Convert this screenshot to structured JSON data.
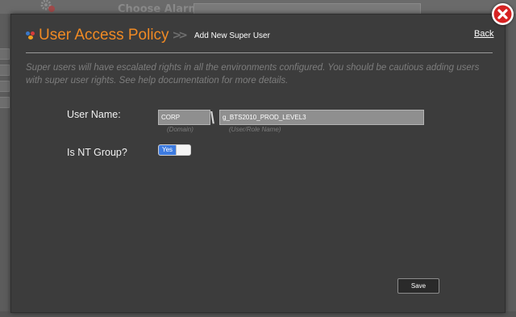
{
  "background": {
    "alarm_label": "Choose Alarm:"
  },
  "header": {
    "title": "User Access Policy",
    "subtitle": "Add New Super User",
    "back_label": "Back"
  },
  "description": "Super users will have escalated rights in all the environments configured. You should be cautious adding users with super user rights. See help documentation for more details.",
  "form": {
    "user_name_label": "User Name:",
    "domain": {
      "value": "CORP",
      "hint": "(Domain)"
    },
    "separator": "\\",
    "user_role": {
      "value": "g_BTS2010_PROD_LEVEL3",
      "hint": "(User/Role Name)"
    },
    "nt_group_label": "Is NT Group?",
    "nt_group_toggle": {
      "label": "Yes",
      "on": true
    }
  },
  "actions": {
    "save_label": "Save"
  },
  "colors": {
    "accent": "#f08a24",
    "toggle_on": "#3d7be0",
    "close": "#d62222"
  },
  "icons": [
    "gear-icon",
    "app-logo-icon",
    "close-icon"
  ]
}
